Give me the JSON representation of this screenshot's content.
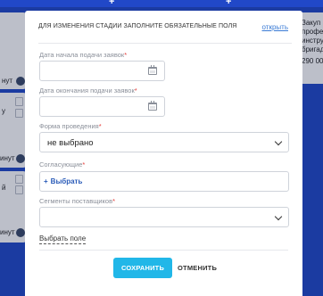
{
  "background": {
    "left_cards": [
      {
        "title": "",
        "footer": "нут"
      },
      {
        "title": "у",
        "footer": "инут"
      },
      {
        "title": "й",
        "footer": "инут"
      }
    ],
    "right_card": {
      "lines": [
        "Закуп",
        "профе",
        "инстру",
        "бригад",
        "290 00"
      ]
    }
  },
  "modal": {
    "header": {
      "title": "ДЛЯ ИЗМЕНЕНИЯ СТАДИИ ЗАПОЛНИТЕ ОБЯЗАТЕЛЬНЫЕ ПОЛЯ",
      "open_link": "открыть"
    },
    "fields": {
      "start_date": {
        "label": "Дата начала подачи заявок",
        "value": ""
      },
      "end_date": {
        "label": "Дата окончания подачи заявок",
        "value": ""
      },
      "form": {
        "label": "Форма проведения",
        "value": "не выбрано"
      },
      "approvers": {
        "label": "Согласующие",
        "add_label": "Выбрать"
      },
      "segments": {
        "label": "Сегменты поставщиков",
        "value": ""
      }
    },
    "required_mark": "*",
    "choose_field_link": "Выбрать поле",
    "save_button": "СОХРАНИТЬ",
    "cancel_button": "ОТМЕНИТЬ"
  },
  "colors": {
    "background": "#2148c8",
    "accent_button": "#21b7e8",
    "link": "#3a7bd5",
    "required": "#e53935"
  }
}
